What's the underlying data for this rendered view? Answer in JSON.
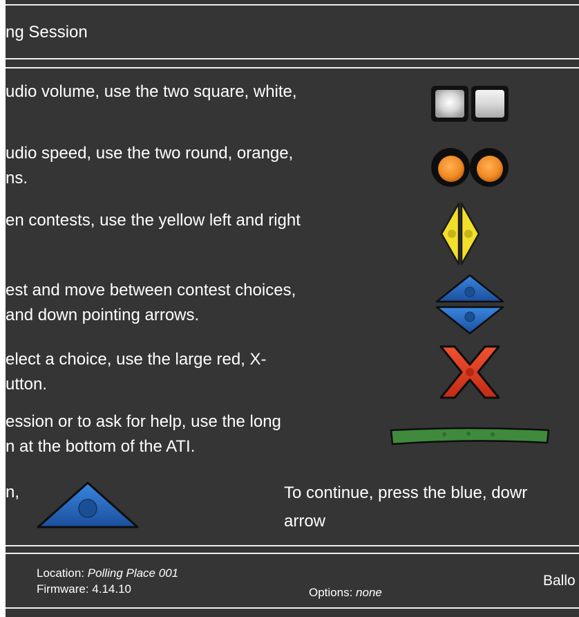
{
  "header": {
    "title": "ng Session"
  },
  "instructions": [
    {
      "line1": "udio volume, use the two square, white,",
      "line2": "",
      "icon": "square-white-buttons-icon"
    },
    {
      "line1": "udio speed, use the two round, orange,",
      "line2": "ns.",
      "icon": "round-orange-buttons-icon"
    },
    {
      "line1": "en contests, use the yellow left and right",
      "line2": "",
      "icon": "yellow-left-right-arrows-icon"
    },
    {
      "line1": "est and move between contest choices,",
      "line2": " and down pointing arrows.",
      "icon": "blue-up-down-arrows-icon"
    },
    {
      "line1": "elect a choice, use the large red, X-",
      "line2": "utton.",
      "icon": "red-x-button-icon"
    },
    {
      "line1": "ession or to ask for help, use the long",
      "line2": "n at the bottom of the ATI.",
      "icon": "long-green-button-icon"
    }
  ],
  "continue_row": {
    "left_text": "n,",
    "instruction_line1": "To continue, press the blue, dowr",
    "instruction_line2": "arrow",
    "icon": "blue-down-arrow-icon"
  },
  "footer": {
    "location_label": "Location:",
    "location_value": "Polling Place 001",
    "firmware_label": "Firmware:",
    "firmware_value": "4.14.10",
    "options_label": "Options:",
    "options_value": "none",
    "ballot_label": "Ballo"
  },
  "colors": {
    "background": "#353535",
    "text": "#ffffff",
    "orange": "#f08a24",
    "yellow": "#f2df2a",
    "blue": "#1f5fb5",
    "red": "#e23c22",
    "green": "#3f8a3c"
  }
}
